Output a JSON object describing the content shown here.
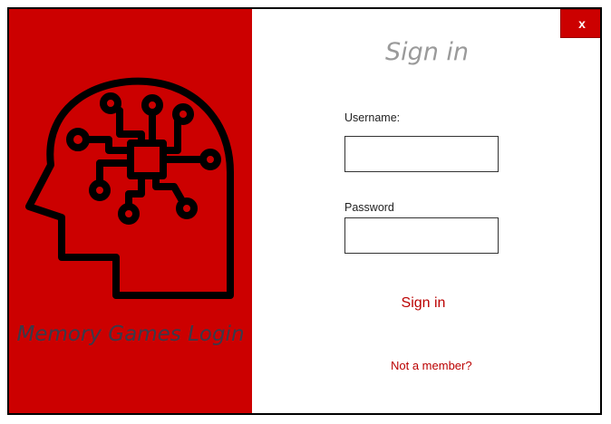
{
  "window": {
    "close_label": "x"
  },
  "brand": {
    "logo_icon": "brain-circuit-icon",
    "title": "Memory Games Login",
    "color": "#cc0000"
  },
  "form": {
    "heading": "Sign in",
    "username_label": "Username:",
    "username_value": "",
    "password_label": "Password",
    "password_value": "",
    "submit_label": "Sign in",
    "register_link": "Not a member?"
  }
}
